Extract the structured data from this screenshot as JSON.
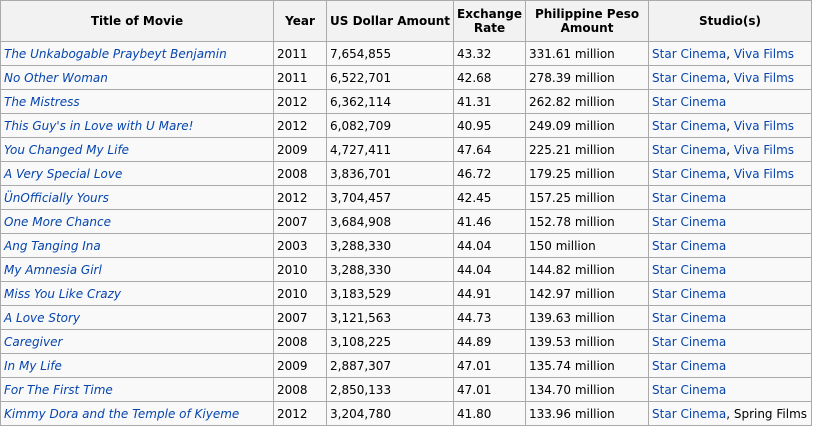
{
  "table": {
    "headers": {
      "title": "Title of Movie",
      "year": "Year",
      "usd": "US Dollar Amount",
      "rate_line1": "Exchange",
      "rate_line2": "Rate",
      "php_line1": "Philippine Peso",
      "php_line2": "Amount",
      "studios": "Studio(s)"
    },
    "rows": [
      {
        "title": "The Unkabogable Praybeyt Benjamin",
        "year": "2011",
        "usd": "7,654,855",
        "rate": "43.32",
        "php": "331.61 million",
        "studios": [
          {
            "name": "Star Cinema",
            "link": true
          },
          {
            "name": "Viva Films",
            "link": true
          }
        ]
      },
      {
        "title": "No Other Woman",
        "year": "2011",
        "usd": "6,522,701",
        "rate": "42.68",
        "php": "278.39 million",
        "studios": [
          {
            "name": "Star Cinema",
            "link": true
          },
          {
            "name": "Viva Films",
            "link": true
          }
        ]
      },
      {
        "title": "The Mistress",
        "year": "2012",
        "usd": "6,362,114",
        "rate": "41.31",
        "php": "262.82 million",
        "studios": [
          {
            "name": "Star Cinema",
            "link": true
          }
        ]
      },
      {
        "title": "This Guy's in Love with U Mare!",
        "year": "2012",
        "usd": "6,082,709",
        "rate": "40.95",
        "php": "249.09 million",
        "studios": [
          {
            "name": "Star Cinema",
            "link": true
          },
          {
            "name": "Viva Films",
            "link": true
          }
        ]
      },
      {
        "title": "You Changed My Life",
        "year": "2009",
        "usd": "4,727,411",
        "rate": "47.64",
        "php": "225.21 million",
        "studios": [
          {
            "name": "Star Cinema",
            "link": true
          },
          {
            "name": "Viva Films",
            "link": true
          }
        ]
      },
      {
        "title": "A Very Special Love",
        "year": "2008",
        "usd": "3,836,701",
        "rate": "46.72",
        "php": "179.25 million",
        "studios": [
          {
            "name": "Star Cinema",
            "link": true
          },
          {
            "name": "Viva Films",
            "link": true
          }
        ]
      },
      {
        "title": "ÜnOfficially Yours",
        "year": "2012",
        "usd": "3,704,457",
        "rate": "42.45",
        "php": "157.25 million",
        "studios": [
          {
            "name": "Star Cinema",
            "link": true
          }
        ]
      },
      {
        "title": "One More Chance",
        "year": "2007",
        "usd": "3,684,908",
        "rate": "41.46",
        "php": "152.78 million",
        "studios": [
          {
            "name": "Star Cinema",
            "link": true
          }
        ]
      },
      {
        "title": "Ang Tanging Ina",
        "year": "2003",
        "usd": "3,288,330",
        "rate": "44.04",
        "php": "150 million",
        "studios": [
          {
            "name": "Star Cinema",
            "link": true
          }
        ]
      },
      {
        "title": "My Amnesia Girl",
        "year": "2010",
        "usd": "3,288,330",
        "rate": "44.04",
        "php": "144.82 million",
        "studios": [
          {
            "name": "Star Cinema",
            "link": true
          }
        ]
      },
      {
        "title": "Miss You Like Crazy",
        "year": "2010",
        "usd": "3,183,529",
        "rate": "44.91",
        "php": "142.97 million",
        "studios": [
          {
            "name": "Star Cinema",
            "link": true
          }
        ]
      },
      {
        "title": "A Love Story",
        "year": "2007",
        "usd": "3,121,563",
        "rate": "44.73",
        "php": "139.63 million",
        "studios": [
          {
            "name": "Star Cinema",
            "link": true
          }
        ]
      },
      {
        "title": "Caregiver",
        "year": "2008",
        "usd": "3,108,225",
        "rate": "44.89",
        "php": "139.53 million",
        "studios": [
          {
            "name": "Star Cinema",
            "link": true
          }
        ]
      },
      {
        "title": "In My Life",
        "year": "2009",
        "usd": "2,887,307",
        "rate": "47.01",
        "php": "135.74 million",
        "studios": [
          {
            "name": "Star Cinema",
            "link": true
          }
        ]
      },
      {
        "title": "For The First Time",
        "year": "2008",
        "usd": "2,850,133",
        "rate": "47.01",
        "php": "134.70 million",
        "studios": [
          {
            "name": "Star Cinema",
            "link": true
          }
        ]
      },
      {
        "title": "Kimmy Dora and the Temple of Kiyeme",
        "year": "2012",
        "usd": "3,204,780",
        "rate": "41.80",
        "php": "133.96 million",
        "studios": [
          {
            "name": "Star Cinema",
            "link": true
          },
          {
            "name": "Spring Films",
            "link": false
          }
        ]
      }
    ]
  }
}
